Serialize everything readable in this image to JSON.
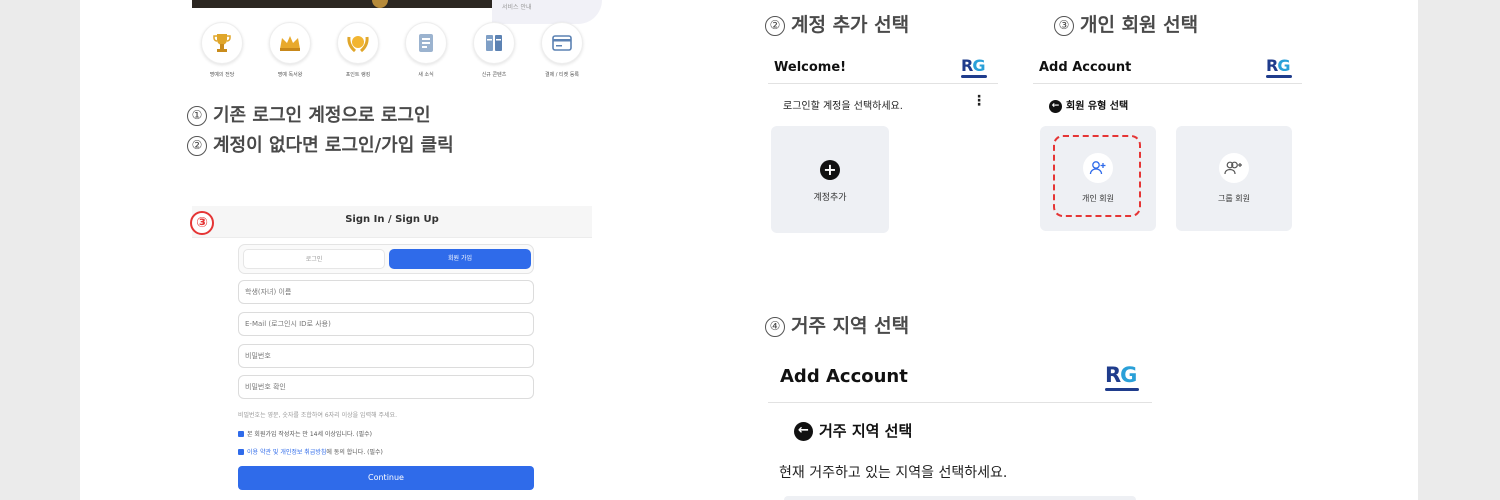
{
  "left": {
    "hero_side_text": "서비스 안내",
    "quick_menu": [
      {
        "icon": "trophy-icon",
        "label": "명예의 전당"
      },
      {
        "icon": "crown-icon",
        "label": "명예 독서왕"
      },
      {
        "icon": "laurel-icon",
        "label": "포인트 랭킹"
      },
      {
        "icon": "news-icon",
        "label": "새 소식"
      },
      {
        "icon": "books-icon",
        "label": "신규 콘텐츠"
      },
      {
        "icon": "payment-icon",
        "label": "결제 / 티켓 등록"
      }
    ],
    "step1": {
      "num": "①",
      "text": "기존 로그인 계정으로 로그인"
    },
    "step2": {
      "num": "②",
      "text": "계정이 없다면 로그인/가입 클릭"
    },
    "signup": {
      "marker": "③",
      "title": "Sign In / Sign Up",
      "tab_login": "로그인",
      "tab_join": "회원 가입",
      "name_placeholder": "학생(자녀) 이름",
      "email_placeholder": "E-Mail (로그인시 ID로 사용)",
      "password_placeholder": "비밀번호",
      "password_confirm_placeholder": "비밀번호 확인",
      "hint": "비밀번호는 영문, 숫자를 조합하여 6자리 이상을 입력해 주세요.",
      "check1": "본 회원가입 작성자는 만 14세 이상입니다. (필수)",
      "check2_link": "이용 약관 및 개인정보 취급방침",
      "check2_rest": "에 동의 합니다. (필수)",
      "continue": "Continue"
    }
  },
  "sec2": {
    "num": "②",
    "title": "계정 추가 선택",
    "header": "Welcome!",
    "prompt": "로그인할 계정을 선택하세요.",
    "more": "⋮",
    "add_label": "계정추가",
    "add_symbol": "+"
  },
  "sec3": {
    "num": "③",
    "title": "개인 회원 선택",
    "header": "Add Account",
    "back_label": "회원 유형 선택",
    "personal": "개인 회원",
    "group": "그룹 회원"
  },
  "sec4": {
    "num": "④",
    "title": "거주 지역 선택",
    "header": "Add Account",
    "back_label": "거주 지역 선택",
    "prompt": "현재 거주하고 있는 지역을 선택하세요."
  },
  "logo": {
    "r": "R",
    "g": "G"
  },
  "colors": {
    "accent": "#2f6bea",
    "highlight": "#e53535",
    "brand_dark": "#1f3c8c",
    "brand_light": "#2aa0d8"
  }
}
